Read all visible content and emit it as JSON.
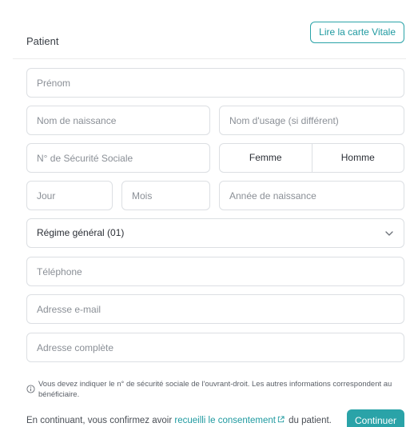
{
  "header": {
    "title": "Patient",
    "read_vitale_label": "Lire la carte Vitale"
  },
  "form": {
    "first_name_placeholder": "Prénom",
    "birth_name_placeholder": "Nom de naissance",
    "usage_name_placeholder": "Nom d'usage (si différent)",
    "ssn_placeholder": "N° de Sécurité Sociale",
    "sex_options": [
      "Femme",
      "Homme"
    ],
    "day_placeholder": "Jour",
    "month_placeholder": "Mois",
    "year_placeholder": "Année de naissance",
    "regime_value": "Régime général (01)",
    "phone_placeholder": "Téléphone",
    "email_placeholder": "Adresse e-mail",
    "address_placeholder": "Adresse complète"
  },
  "info": {
    "text": "Vous devez indiquer le n° de sécurité sociale de l'ouvrant-droit. Les autres informations correspondent au bénéficiaire."
  },
  "footer": {
    "prefix": "En continuant, vous confirmez avoir ",
    "link": "recueilli le consentement",
    "suffix": " du patient.",
    "continue_label": "Continuer"
  },
  "colors": {
    "accent": "#2aa3a8",
    "border": "#dcdfe3"
  }
}
